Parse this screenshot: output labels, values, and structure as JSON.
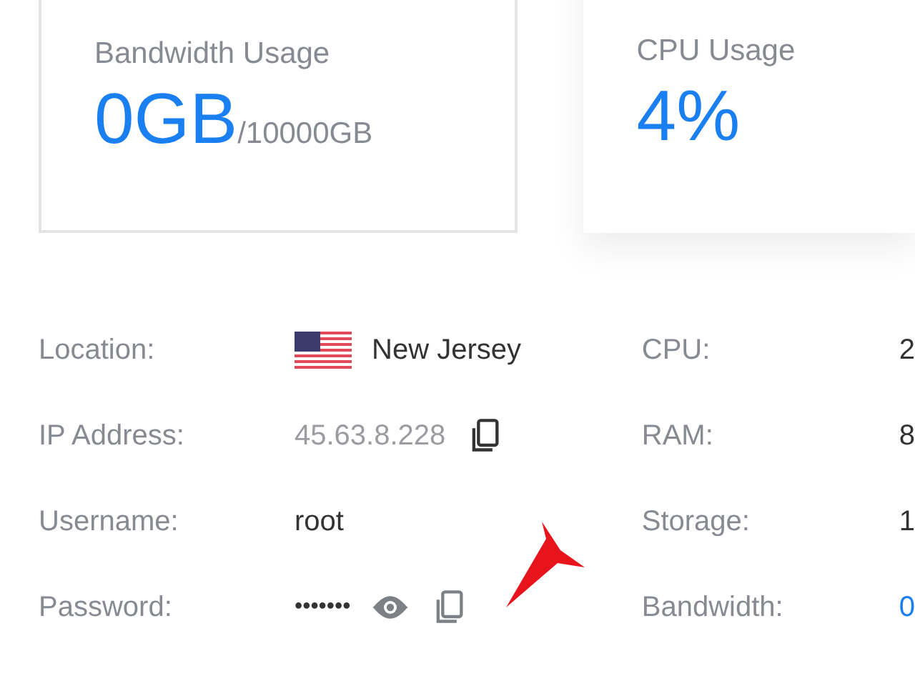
{
  "cards": [
    {
      "title": "Bandwidth Usage",
      "value": "0GB",
      "suffix": "/10000GB",
      "kind": "bordered"
    },
    {
      "title": "CPU Usage",
      "value": "4%",
      "kind": "shadow"
    }
  ],
  "details_left": [
    {
      "label": "Location:",
      "value": "New Jersey",
      "kind": "flag"
    },
    {
      "label": "IP Address:",
      "value": "45.63.8.228",
      "kind": "copy"
    },
    {
      "label": "Username:",
      "value": "root",
      "kind": "plain"
    },
    {
      "label": "Password:",
      "value": "•••••••",
      "kind": "secret"
    }
  ],
  "details_right": [
    {
      "label": "CPU:",
      "value": "2",
      "link": false
    },
    {
      "label": "RAM:",
      "value": "8",
      "link": false
    },
    {
      "label": "Storage:",
      "value": "1",
      "link": false
    },
    {
      "label": "Bandwidth:",
      "value": "0",
      "link": true
    }
  ]
}
